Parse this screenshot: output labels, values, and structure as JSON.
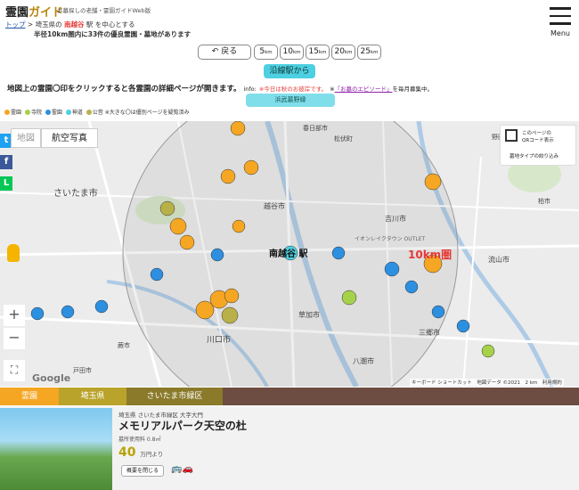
{
  "header": {
    "logo_part1": "霊園",
    "logo_part2": "ガイド",
    "tagline": "お墓探しの老舗・霊園ガイドWeb版",
    "breadcrumb_home": "トップ",
    "breadcrumb_sep": ">",
    "breadcrumb_pref": "埼玉県の",
    "breadcrumb_station": "南越谷",
    "breadcrumb_suffix": "駅 を中心とする",
    "subline": "半径10km圏内に33件の優良霊園・墓地があります",
    "menu_label": "Menu"
  },
  "controls": {
    "back_label": "戻る",
    "distances": [
      {
        "num": "5",
        "unit": "km"
      },
      {
        "num": "10",
        "unit": "km"
      },
      {
        "num": "15",
        "unit": "km"
      },
      {
        "num": "20",
        "unit": "km"
      },
      {
        "num": "25",
        "unit": "km"
      }
    ],
    "route_label": "沿線駅から",
    "center_label": "浜武墓野縁"
  },
  "info": {
    "main": "地図上の霊園〇印をクリックすると各霊園の詳細ページが開きます。",
    "info_prefix": "info:",
    "info_red": "※今日は秋のお彼岸です。",
    "info_note": "※",
    "info_link": "「お墓のエピソード」",
    "info_suffix": "を毎月募集中。"
  },
  "legend": {
    "items": [
      {
        "label": "霊園",
        "color": "#f5a623"
      },
      {
        "label": "寺院",
        "color": "#a6d24b"
      },
      {
        "label": "霊園",
        "color": "#2d8fe0"
      },
      {
        "label": "神道",
        "color": "#4dd0e1"
      },
      {
        "label": "公営",
        "color": "#b9b04a"
      }
    ],
    "note": "※大きな〇は優別ページを疑覧済み"
  },
  "map": {
    "tab_map": "地図",
    "tab_aerial": "航空写真",
    "qr_title": "このページの",
    "qr_sub": "QRコード表示",
    "map_type": "墓地タイプの絞り込み",
    "center_station": "南越谷 駅",
    "radius_label": "10km圏",
    "city_saitama": "さいたま市",
    "city_kawaguchi": "川口市",
    "city_koshigaya": "越谷市",
    "city_soka": "草加市",
    "city_yashio": "八潮市",
    "city_misato": "三郷市",
    "city_nagareyama": "流山市",
    "city_kasukabe": "春日部市",
    "city_matsubushi": "松伏町",
    "city_yoshikawa": "吉川市",
    "city_warabi": "蕨市",
    "city_toda": "戸田市",
    "city_kashiwa": "柏市",
    "city_noda": "野田市",
    "outlet": "イオンレイクタウン OUTLET",
    "zoom_in": "+",
    "zoom_out": "−",
    "google": "Google",
    "footer": "キーボード ショートカット　地図データ ©2021　2 km　利用規約"
  },
  "tabs": {
    "t1": "霊園",
    "t2": "埼玉県",
    "t3": "さいたま市緑区"
  },
  "card": {
    "address": "埼玉県 さいたま市緑区 大字大門",
    "name": "メモリアルパーク天空の杜",
    "walk": "墓所使用料 0.8㎡",
    "price": "40",
    "price_unit": "万円より",
    "close_label": "概要を閉じる",
    "transport": "🚌🚗"
  }
}
